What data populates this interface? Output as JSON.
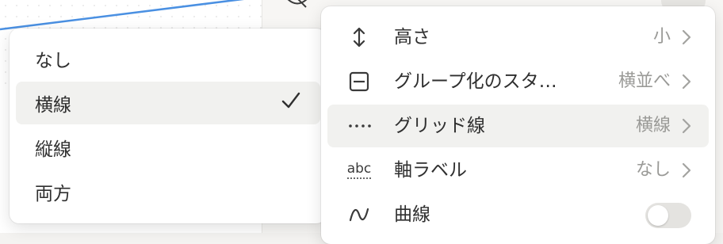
{
  "dropdown": {
    "options": [
      {
        "label": "なし",
        "selected": false
      },
      {
        "label": "横線",
        "selected": true
      },
      {
        "label": "縦線",
        "selected": false
      },
      {
        "label": "両方",
        "selected": false
      }
    ],
    "check_icon": "checkmark-icon"
  },
  "menu": {
    "rows": [
      {
        "icon": "height-arrows-icon",
        "label": "高さ",
        "value": "小"
      },
      {
        "icon": "group-icon",
        "label": "グループ化のスタ…",
        "value": "横並べ"
      },
      {
        "icon": "dotted-line-icon",
        "label": "グリッド線",
        "value": "横線"
      },
      {
        "icon": "abc-icon",
        "label": "軸ラベル",
        "value": "なし"
      },
      {
        "icon": "curve-icon",
        "label": "曲線",
        "toggle": false
      }
    ],
    "abc_text": "abc"
  },
  "colors": {
    "accent_line": "#4a90e2",
    "selected_bg": "#f1f1ef",
    "value_text": "#9a9a97"
  }
}
